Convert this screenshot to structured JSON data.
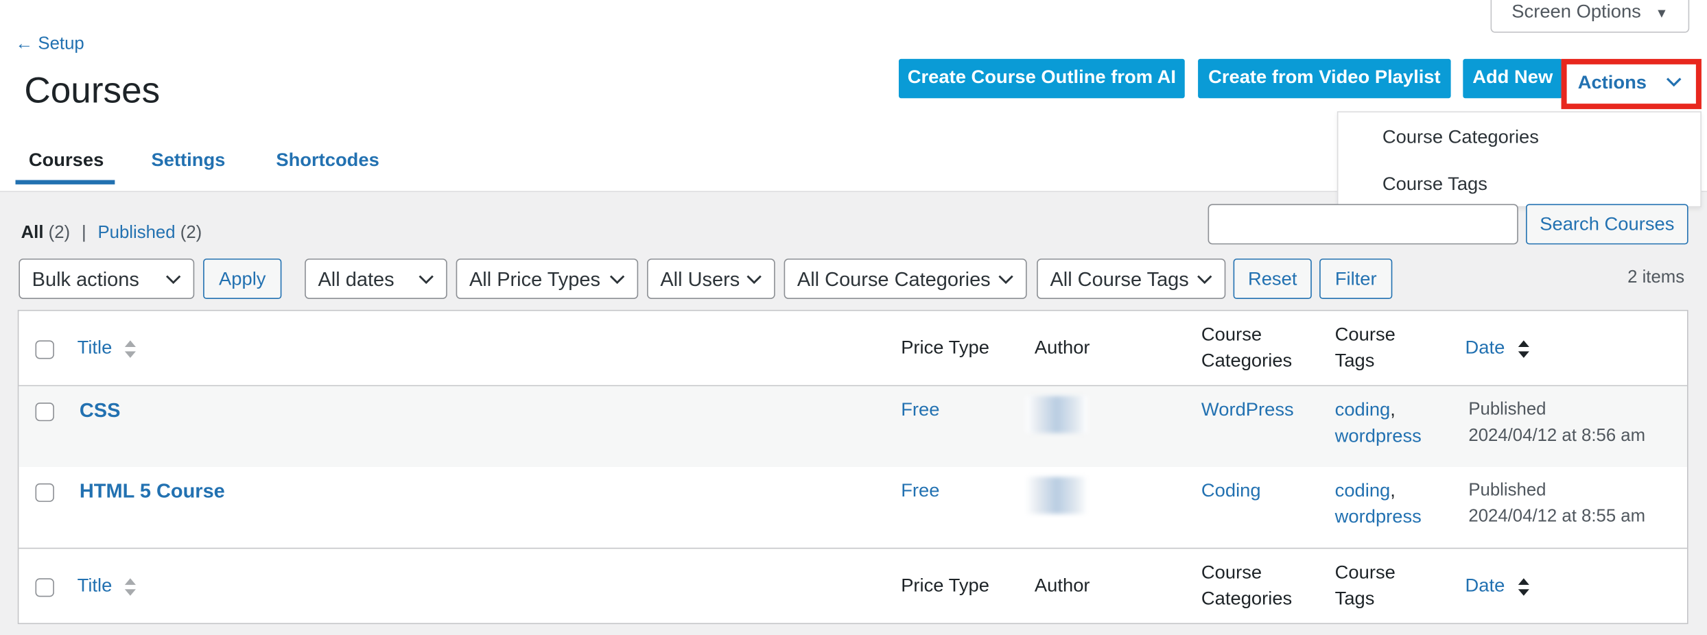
{
  "screen_options": "Screen Options",
  "back_link": "← Setup",
  "page_title": "Courses",
  "header_buttons": {
    "outline_ai": "Create Course Outline from AI",
    "video_playlist": "Create from Video Playlist",
    "add_new": "Add New",
    "actions": "Actions"
  },
  "actions_menu": [
    "Course Categories",
    "Course Tags"
  ],
  "tabs": [
    "Courses",
    "Settings",
    "Shortcodes"
  ],
  "subsubsub": {
    "all_label": "All",
    "all_count": "(2)",
    "separator": "|",
    "published_label": "Published",
    "published_count": "(2)"
  },
  "search": {
    "placeholder": "",
    "button": "Search Courses"
  },
  "filters": {
    "bulk_actions": "Bulk actions",
    "apply": "Apply",
    "dates": "All dates",
    "price_types": "All Price Types",
    "users": "All Users",
    "course_categories": "All Course Categories",
    "course_tags": "All Course Tags",
    "reset": "Reset",
    "filter": "Filter"
  },
  "items_count": "2 items",
  "table": {
    "columns": {
      "title": "Title",
      "price_type": "Price Type",
      "author": "Author",
      "categories_l1": "Course",
      "categories_l2": "Categories",
      "tags_l1": "Course",
      "tags_l2": "Tags",
      "date": "Date"
    },
    "rows": [
      {
        "title": "CSS",
        "price_type": "Free",
        "category": "WordPress",
        "tag1": "coding",
        "tag2": "wordpress",
        "status": "Published",
        "date": "2024/04/12 at 8:56 am"
      },
      {
        "title": "HTML 5 Course",
        "price_type": "Free",
        "category": "Coding",
        "tag1": "coding",
        "tag2": "wordpress",
        "status": "Published",
        "date": "2024/04/12 at 8:55 am"
      }
    ]
  },
  "colors": {
    "accent": "#2271b1",
    "primary_button": "#0a9bd6",
    "highlight": "#e8271e"
  }
}
